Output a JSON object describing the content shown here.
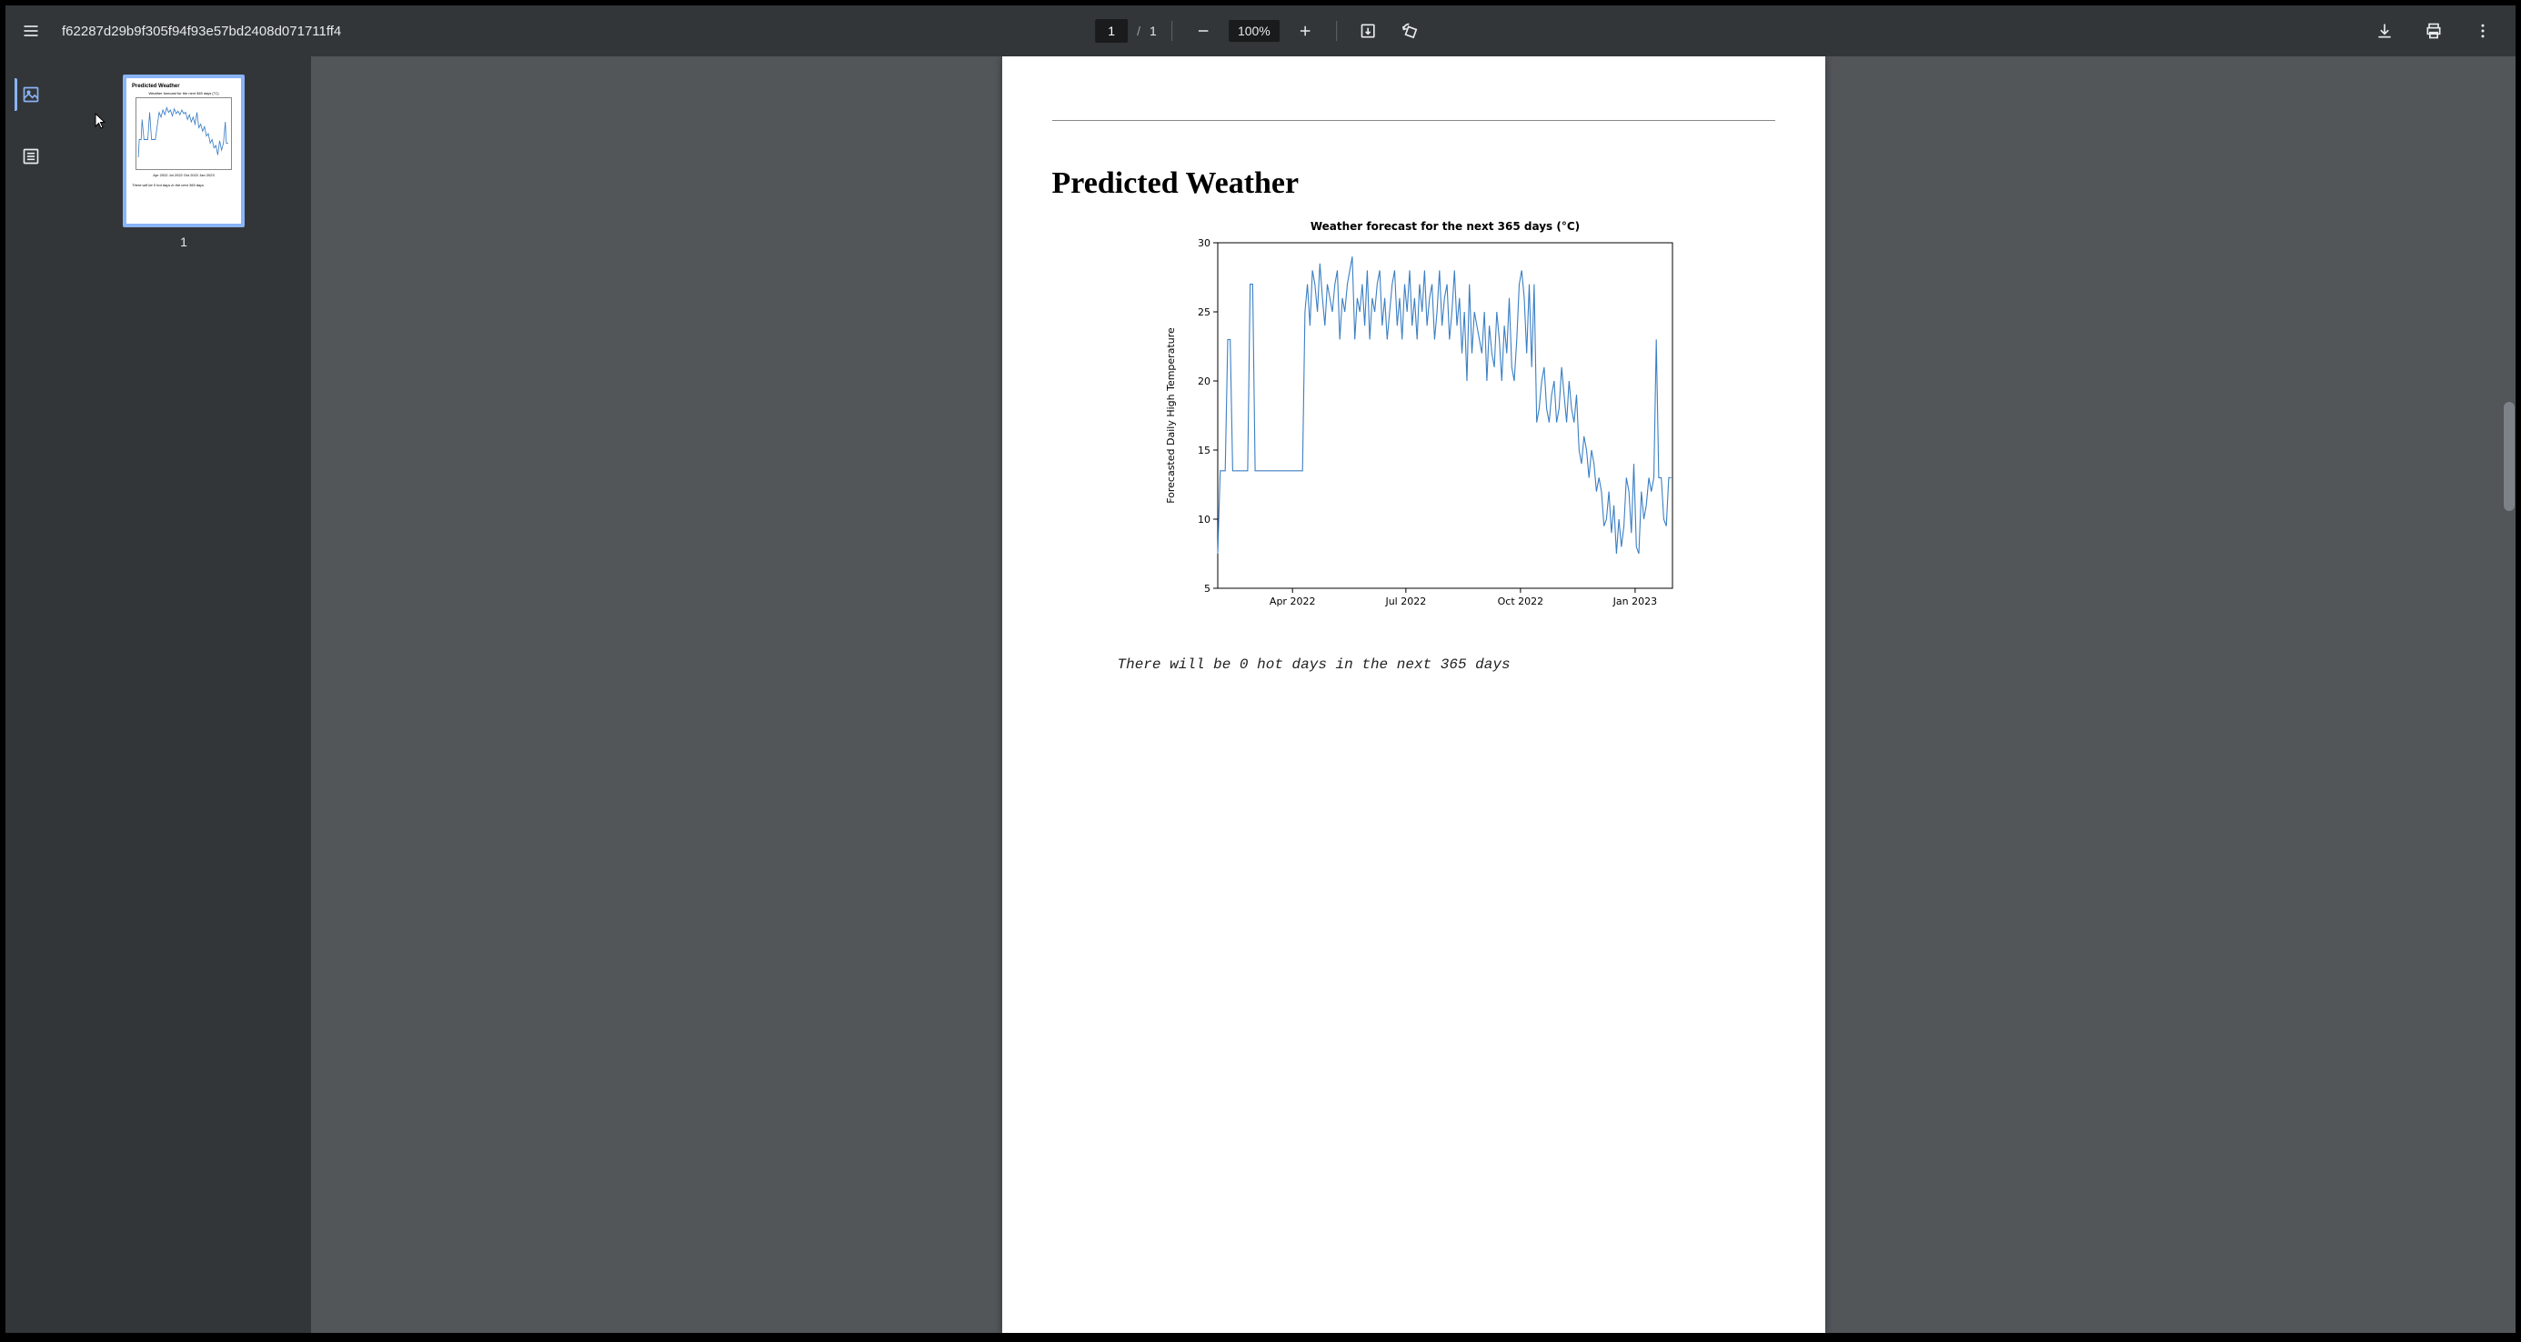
{
  "toolbar": {
    "title": "f62287d29b9f305f94f93e57bd2408d071711ff4",
    "page_current": "1",
    "page_total": "1",
    "page_sep": "/",
    "zoom": "100%"
  },
  "thumbs": {
    "page1_label": "1"
  },
  "document": {
    "heading": "Predicted Weather",
    "caption": "There will be 0 hot days in the next 365 days"
  },
  "chart_data": {
    "type": "line",
    "title": "Weather forecast for the next 365 days (°C)",
    "xlabel": "",
    "ylabel": "Forecasted Daily High Temperature",
    "ylim": [
      5,
      30
    ],
    "yticks": [
      5,
      10,
      15,
      20,
      25,
      30
    ],
    "xticks": [
      "Apr 2022",
      "Jul 2022",
      "Oct 2022",
      "Jan 2023"
    ],
    "xtick_positions_days": [
      60,
      151,
      243,
      335
    ],
    "x": [
      0,
      2,
      4,
      6,
      8,
      10,
      12,
      14,
      16,
      18,
      20,
      22,
      24,
      26,
      28,
      30,
      32,
      34,
      36,
      38,
      40,
      42,
      44,
      46,
      48,
      50,
      52,
      54,
      56,
      58,
      60,
      62,
      64,
      66,
      68,
      70,
      72,
      74,
      76,
      78,
      80,
      82,
      84,
      86,
      88,
      90,
      92,
      94,
      96,
      98,
      100,
      102,
      104,
      106,
      108,
      110,
      112,
      114,
      116,
      118,
      120,
      122,
      124,
      126,
      128,
      130,
      132,
      134,
      136,
      138,
      140,
      142,
      144,
      146,
      148,
      150,
      152,
      154,
      156,
      158,
      160,
      162,
      164,
      166,
      168,
      170,
      172,
      174,
      176,
      178,
      180,
      182,
      184,
      186,
      188,
      190,
      192,
      194,
      196,
      198,
      200,
      202,
      204,
      206,
      208,
      210,
      212,
      214,
      216,
      218,
      220,
      222,
      224,
      226,
      228,
      230,
      232,
      234,
      236,
      238,
      240,
      242,
      244,
      246,
      248,
      250,
      252,
      254,
      256,
      258,
      260,
      262,
      264,
      266,
      268,
      270,
      272,
      274,
      276,
      278,
      280,
      282,
      284,
      286,
      288,
      290,
      292,
      294,
      296,
      298,
      300,
      302,
      304,
      306,
      308,
      310,
      312,
      314,
      316,
      318,
      320,
      322,
      324,
      326,
      328,
      330,
      332,
      334,
      336,
      338,
      340,
      342,
      344,
      346,
      348,
      350,
      352,
      354,
      356,
      358,
      360,
      362,
      364
    ],
    "y": [
      7.5,
      13.5,
      13.5,
      13.5,
      23,
      23,
      13.5,
      13.5,
      13.5,
      13.5,
      13.5,
      13.5,
      13.5,
      27,
      27,
      13.5,
      13.5,
      13.5,
      13.5,
      13.5,
      13.5,
      13.5,
      13.5,
      13.5,
      13.5,
      13.5,
      13.5,
      13.5,
      13.5,
      13.5,
      13.5,
      13.5,
      13.5,
      13.5,
      13.5,
      25,
      27,
      24,
      28,
      27,
      25,
      28.5,
      26,
      24,
      27,
      26,
      25,
      27,
      28,
      23,
      26,
      25,
      27,
      28,
      29,
      23,
      26,
      25,
      27,
      24,
      28,
      23,
      26,
      25,
      27,
      28,
      24,
      26,
      23,
      25,
      27,
      28,
      24,
      26,
      23,
      27,
      25,
      28,
      24,
      26,
      23,
      27,
      25,
      28,
      24,
      26,
      27,
      23,
      25,
      28,
      24,
      26,
      27,
      23,
      25,
      28,
      24,
      26,
      22,
      25,
      20,
      27,
      22,
      25,
      24,
      23,
      22,
      25,
      20,
      24,
      22,
      21,
      25,
      23,
      20,
      24,
      22,
      26,
      21,
      20,
      23,
      27,
      28,
      26,
      22,
      27,
      21,
      27,
      17,
      18,
      20,
      21,
      18,
      17,
      19,
      20,
      17,
      18,
      21,
      19,
      17,
      20,
      18,
      17,
      19,
      15,
      14,
      16,
      15,
      13,
      15,
      14,
      12,
      13,
      12,
      9.5,
      10,
      12,
      9,
      11,
      7.5,
      10,
      8,
      9.5,
      13,
      12,
      9,
      14,
      8,
      7.5,
      12,
      10,
      11,
      13,
      12,
      13,
      23,
      13,
      13,
      10,
      9.5,
      13,
      13,
      13.5,
      13.5
    ]
  }
}
